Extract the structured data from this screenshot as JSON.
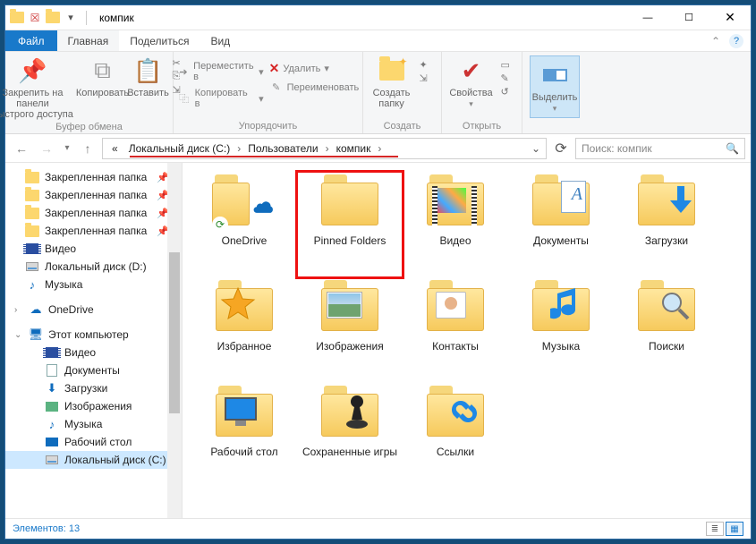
{
  "window": {
    "title": "компик",
    "minimize": "—",
    "maximize": "☐",
    "close": "✕"
  },
  "menu": {
    "file": "Файл",
    "tabs": [
      "Главная",
      "Поделиться",
      "Вид"
    ],
    "help": "?"
  },
  "ribbon": {
    "group1": {
      "pin": "Закрепить на панели\nбыстрого доступа",
      "copy": "Копировать",
      "paste": "Вставить",
      "label": "Буфер обмена"
    },
    "group2": {
      "move": "Переместить в",
      "copyto": "Копировать в",
      "delete": "Удалить",
      "rename": "Переименовать",
      "label": "Упорядочить"
    },
    "group3": {
      "newfolder": "Создать\nпапку",
      "label": "Создать"
    },
    "group4": {
      "properties": "Свойства",
      "label": "Открыть"
    },
    "group5": {
      "select": "Выделить"
    }
  },
  "breadcrumb": {
    "prefix": "«",
    "items": [
      "Локальный диск (C:)",
      "Пользователи",
      "компик"
    ],
    "sep": "›"
  },
  "search": {
    "placeholder": "Поиск: компик"
  },
  "tree": {
    "pinned": "Закрепленная папка",
    "video": "Видео",
    "diskD": "Локальный диск (D:)",
    "music": "Музыка",
    "onedrive": "OneDrive",
    "thispc": "Этот компьютер",
    "docs": "Документы",
    "downloads": "Загрузки",
    "images": "Изображения",
    "desktop": "Рабочий стол",
    "diskC": "Локальный диск (C:)"
  },
  "items": [
    {
      "name": "OneDrive",
      "icon": "onedrive"
    },
    {
      "name": "Pinned Folders",
      "icon": "folder",
      "highlight": true
    },
    {
      "name": "Видео",
      "icon": "video"
    },
    {
      "name": "Документы",
      "icon": "docs"
    },
    {
      "name": "Загрузки",
      "icon": "downloads"
    },
    {
      "name": "Избранное",
      "icon": "favorites"
    },
    {
      "name": "Изображения",
      "icon": "images"
    },
    {
      "name": "Контакты",
      "icon": "contacts"
    },
    {
      "name": "Музыка",
      "icon": "music"
    },
    {
      "name": "Поиски",
      "icon": "search"
    },
    {
      "name": "Рабочий стол",
      "icon": "desktop"
    },
    {
      "name": "Сохраненные игры",
      "icon": "games"
    },
    {
      "name": "Ссылки",
      "icon": "links"
    }
  ],
  "status": {
    "count_label": "Элементов:",
    "count": "13"
  }
}
